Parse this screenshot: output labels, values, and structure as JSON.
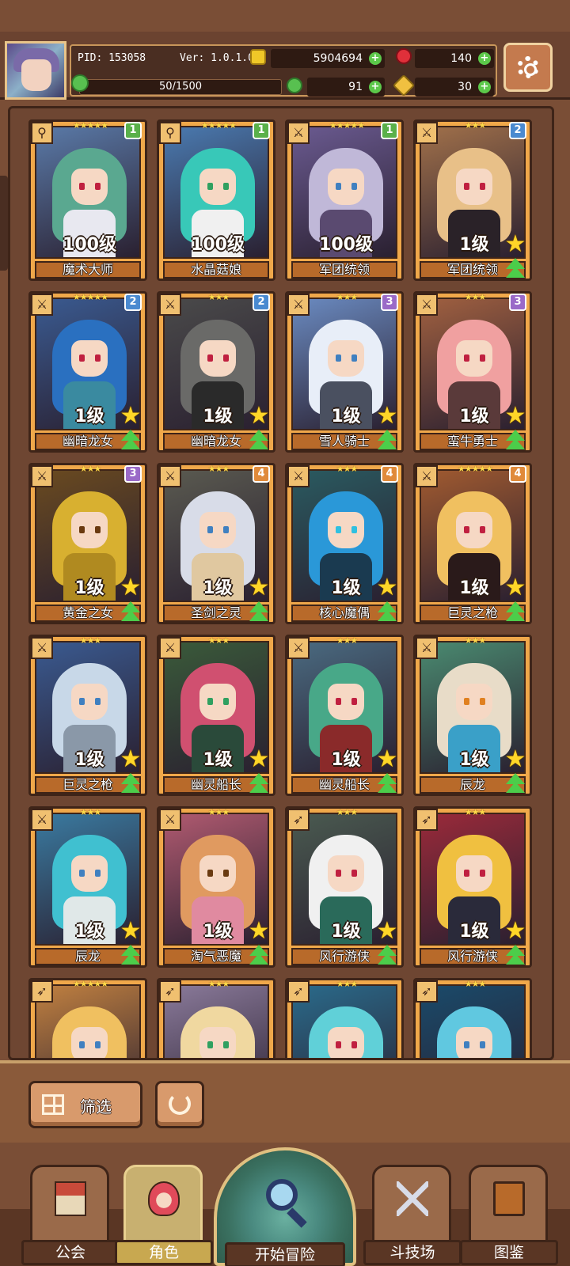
{
  "header": {
    "pid": "PID: 153058",
    "version": "Ver: 1.0.1.0",
    "gold": "5904694",
    "gems": "140",
    "clover": "91",
    "keys": "30",
    "exp": "50/1500"
  },
  "colors": {
    "tier1": "#5ab04a",
    "tier2": "#4a8ad0",
    "tier3": "#9a6ac8",
    "tier4": "#e08a3a",
    "plus": "#5cc84a",
    "upgrade": "#4ccd4a",
    "star": "#ffd628"
  },
  "cards": [
    {
      "name": "魔术大师",
      "level": "100级",
      "stars": "★★★★★",
      "tier": "1",
      "class_icon": "wand-icon",
      "upgradable": false,
      "hair": "#5aa890",
      "body": "#e8e8f0",
      "bg": "#5a7aa8",
      "eye": "#c02040"
    },
    {
      "name": "水晶菇娘",
      "level": "100级",
      "stars": "★★★★★",
      "tier": "1",
      "class_icon": "wand-icon",
      "upgradable": false,
      "hair": "#38c8b8",
      "body": "#f0f0f0",
      "bg": "#4a7ab0",
      "eye": "#30a060"
    },
    {
      "name": "军团统领",
      "level": "100级",
      "stars": "★★★★★",
      "tier": "1",
      "class_icon": "sword-icon",
      "upgradable": false,
      "hair": "#c0b8d8",
      "body": "#5a4a70",
      "bg": "#6a5a90",
      "eye": "#4080c0"
    },
    {
      "name": "军团统领",
      "level": "1级",
      "stars": "★★★",
      "tier": "2",
      "class_icon": "sword-icon",
      "upgradable": true,
      "hair": "#e8c088",
      "body": "#2a2228",
      "bg": "#a0704a",
      "eye": "#c02040"
    },
    {
      "name": "幽暗龙女",
      "level": "1级",
      "stars": "★★★★★",
      "tier": "2",
      "class_icon": "sword-icon",
      "upgradable": true,
      "hair": "#2a70c0",
      "body": "#3a8aa0",
      "bg": "#3a5a90",
      "eye": "#c02040"
    },
    {
      "name": "幽暗龙女",
      "level": "1级",
      "stars": "★★★",
      "tier": "2",
      "class_icon": "sword-icon",
      "upgradable": true,
      "hair": "#6a6a68",
      "body": "#2a2a2a",
      "bg": "#4a4a4a",
      "eye": "#c02040"
    },
    {
      "name": "雪人骑士",
      "level": "1级",
      "stars": "★★★",
      "tier": "3",
      "class_icon": "sword-icon",
      "upgradable": true,
      "hair": "#e8eef8",
      "body": "#4a5060",
      "bg": "#6a8ac0",
      "eye": "#4080c0"
    },
    {
      "name": "蛮牛勇士",
      "level": "1级",
      "stars": "★★★",
      "tier": "3",
      "class_icon": "sword-icon",
      "upgradable": true,
      "hair": "#f0a0a0",
      "body": "#5a3a3a",
      "bg": "#a06040",
      "eye": "#c02040"
    },
    {
      "name": "黄金之女",
      "level": "1级",
      "stars": "★★★",
      "tier": "3",
      "class_icon": "sword-icon",
      "upgradable": true,
      "hair": "#d8b030",
      "body": "#b08a20",
      "bg": "#6a4a20",
      "eye": "#6a3a10"
    },
    {
      "name": "圣剑之灵",
      "level": "1级",
      "stars": "★★★",
      "tier": "4",
      "class_icon": "sword-icon",
      "upgradable": true,
      "hair": "#d8dce8",
      "body": "#e0c8a0",
      "bg": "#5a5a50",
      "eye": "#4080c0"
    },
    {
      "name": "核心魔偶",
      "level": "1级",
      "stars": "★★★",
      "tier": "4",
      "class_icon": "sword-icon",
      "upgradable": true,
      "hair": "#2a98d8",
      "body": "#1a3a50",
      "bg": "#2a5a60",
      "eye": "#30c0e0"
    },
    {
      "name": "巨灵之枪",
      "level": "1级",
      "stars": "★★★★★",
      "tier": "4",
      "class_icon": "sword-icon",
      "upgradable": true,
      "hair": "#f0c060",
      "body": "#2a1a1a",
      "bg": "#a05a30",
      "eye": "#c02040"
    },
    {
      "name": "巨灵之枪",
      "level": "1级",
      "stars": "★★★",
      "tier": "",
      "class_icon": "sword-icon",
      "upgradable": true,
      "hair": "#c8d8e8",
      "body": "#8a98a8",
      "bg": "#3a5a90",
      "eye": "#4080c0"
    },
    {
      "name": "幽灵船长",
      "level": "1级",
      "stars": "★★★",
      "tier": "",
      "class_icon": "sword-icon",
      "upgradable": true,
      "hair": "#d05070",
      "body": "#2a4a3a",
      "bg": "#3a5a3a",
      "eye": "#30a060"
    },
    {
      "name": "幽灵船长",
      "level": "1级",
      "stars": "★★★",
      "tier": "",
      "class_icon": "sword-icon",
      "upgradable": true,
      "hair": "#48a888",
      "body": "#8a2a2a",
      "bg": "#4a6a80",
      "eye": "#c02040"
    },
    {
      "name": "辰龙",
      "level": "1级",
      "stars": "★★★",
      "tier": "",
      "class_icon": "sword-icon",
      "upgradable": true,
      "hair": "#e8dcc8",
      "body": "#3aa0c8",
      "bg": "#4a8a70",
      "eye": "#e08020"
    },
    {
      "name": "辰龙",
      "level": "1级",
      "stars": "★★★",
      "tier": "",
      "class_icon": "sword-icon",
      "upgradable": true,
      "hair": "#40c0d0",
      "body": "#e0e8e8",
      "bg": "#3a7aa0",
      "eye": "#4080c0"
    },
    {
      "name": "淘气恶魔",
      "level": "1级",
      "stars": "★★★",
      "tier": "",
      "class_icon": "sword-icon",
      "upgradable": true,
      "hair": "#e09a60",
      "body": "#e08aa0",
      "bg": "#b05a70",
      "eye": "#6a3a10"
    },
    {
      "name": "风行游侠",
      "level": "1级",
      "stars": "★★★",
      "tier": "",
      "class_icon": "bow-icon",
      "upgradable": true,
      "hair": "#f0f0f0",
      "body": "#2a6a5a",
      "bg": "#4a5a50",
      "eye": "#c02040"
    },
    {
      "name": "风行游侠",
      "level": "1级",
      "stars": "★★★",
      "tier": "",
      "class_icon": "bow-icon",
      "upgradable": true,
      "hair": "#f0c040",
      "body": "#2a2a3a",
      "bg": "#9a2a3a",
      "eye": "#c02040"
    },
    {
      "name": "",
      "level": "",
      "stars": "★★★★★",
      "tier": "",
      "class_icon": "bow-icon",
      "upgradable": false,
      "hair": "#f0c060",
      "body": "#e0a070",
      "bg": "#c08040",
      "eye": "#4080c0"
    },
    {
      "name": "",
      "level": "",
      "stars": "★★★",
      "tier": "",
      "class_icon": "bow-icon",
      "upgradable": false,
      "hair": "#f0d8a0",
      "body": "#d8d0c0",
      "bg": "#8a7a9a",
      "eye": "#30a060"
    },
    {
      "name": "",
      "level": "",
      "stars": "★★★",
      "tier": "",
      "class_icon": "bow-icon",
      "upgradable": false,
      "hair": "#60d0d8",
      "body": "#4aa0c0",
      "bg": "#2a6a8a",
      "eye": "#c02040"
    },
    {
      "name": "",
      "level": "",
      "stars": "★★★",
      "tier": "",
      "class_icon": "bow-icon",
      "upgradable": false,
      "hair": "#60c8e0",
      "body": "#3a90b0",
      "bg": "#1a4a6a",
      "eye": "#4080c0"
    }
  ],
  "toolbar": {
    "filter_label": "筛选"
  },
  "nav": {
    "guild": "公会",
    "characters": "角色",
    "adventure": "开始冒险",
    "arena": "斗技场",
    "codex": "图鉴"
  }
}
